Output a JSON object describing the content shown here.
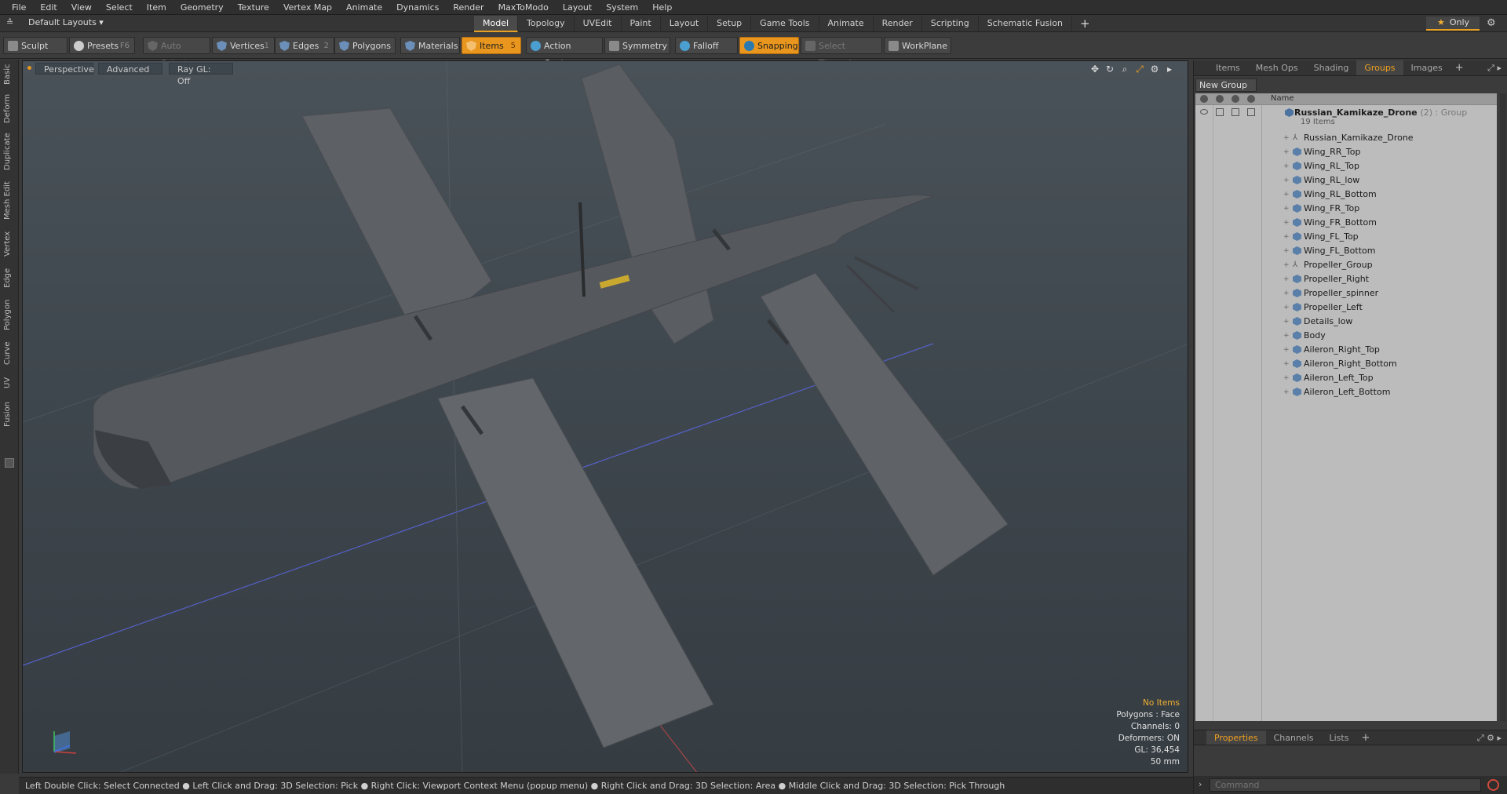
{
  "menu": [
    "File",
    "Edit",
    "View",
    "Select",
    "Item",
    "Geometry",
    "Texture",
    "Vertex Map",
    "Animate",
    "Dynamics",
    "Render",
    "MaxToModo",
    "Layout",
    "System",
    "Help"
  ],
  "layout": {
    "dropdown": "Default Layouts ▾"
  },
  "tabs": [
    "Model",
    "Topology",
    "UVEdit",
    "Paint",
    "Layout",
    "Setup",
    "Game Tools",
    "Animate",
    "Render",
    "Scripting",
    "Schematic Fusion"
  ],
  "tabs_plus": "+",
  "only_label": "Only",
  "toolbar": {
    "sculpt": "Sculpt",
    "presets": "Presets",
    "presets_key": "F6",
    "auto_select": "Auto Select",
    "vertices": "Vertices",
    "vertices_key": "1",
    "edges": "Edges",
    "edges_key": "2",
    "polygons": "Polygons",
    "materials": "Materials",
    "items": "Items",
    "items_key": "5",
    "action_center": "Action Center",
    "symmetry": "Symmetry",
    "falloff": "Falloff",
    "snapping": "Snapping",
    "select_through": "Select Through",
    "workplane": "WorkPlane"
  },
  "sidetabs": [
    "Basic",
    "Deform",
    "Duplicate",
    "Mesh Edit",
    "Vertex",
    "Edge",
    "Polygon",
    "Curve",
    "UV",
    "Fusion"
  ],
  "viewport": {
    "view": "Perspective",
    "shading": "Advanced",
    "raygl": "Ray GL: Off",
    "info": {
      "items": "No Items",
      "polygons": "Polygons : Face",
      "channels": "Channels: 0",
      "deformers": "Deformers: ON",
      "gl": "GL: 36,454",
      "mm": "50 mm"
    }
  },
  "status": "Left Double Click: Select Connected ● Left Click and Drag: 3D Selection: Pick ● Right Click: Viewport Context Menu (popup menu) ● Right Click and Drag: 3D Selection: Area ● Middle Click and Drag: 3D Selection: Pick Through",
  "rpanel": {
    "tabs": [
      "Items",
      "Mesh Ops",
      "Shading",
      "Groups",
      "Images"
    ],
    "active_tab": "Groups",
    "new_group": "New Group",
    "col_name": "Name",
    "group": {
      "name": "Russian_Kamikaze_Drone",
      "tag": "(2) : Group",
      "count": "19 Items"
    },
    "items": [
      "Russian_Kamikaze_Drone",
      "Wing_RR_Top",
      "Wing_RL_Top",
      "Wing_RL_low",
      "Wing_RL_Bottom",
      "Wing_FR_Top",
      "Wing_FR_Bottom",
      "Wing_FL_Top",
      "Wing_FL_Bottom",
      "Propeller_Group",
      "Propeller_Right",
      "Propeller_spinner",
      "Propeller_Left",
      "Details_low",
      "Body",
      "Aileron_Right_Top",
      "Aileron_Right_Bottom",
      "Aileron_Left_Top",
      "Aileron_Left_Bottom"
    ],
    "bottom_tabs": [
      "Properties",
      "Channels",
      "Lists"
    ],
    "command_placeholder": "Command"
  },
  "colors": {
    "accent": "#e8961e",
    "active_tab_text": "#f0a020",
    "list_bg": "#bcbcbc"
  }
}
